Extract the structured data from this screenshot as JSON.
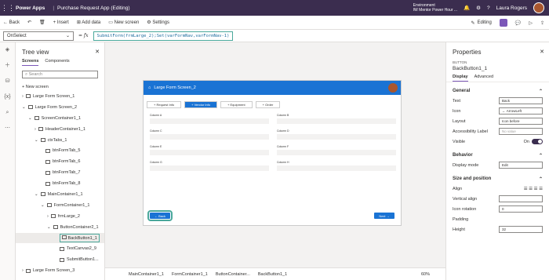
{
  "topbar": {
    "app": "Power Apps",
    "title": "Purchase Request App (Editing)",
    "env_label": "Environment",
    "env_name": "IW Mentor Power Hour ...",
    "user": "Laura Rogers"
  },
  "cmdbar": {
    "back": "Back",
    "insert": "Insert",
    "add_data": "Add data",
    "new_screen": "New screen",
    "settings": "Settings",
    "editing": "Editing"
  },
  "formula": {
    "property": "OnSelect",
    "expression": "SubmitForm(frmLarge_2);Set(varFormNav,varFormNav-1)"
  },
  "tree": {
    "title": "Tree view",
    "tabs": [
      "Screens",
      "Components"
    ],
    "search_placeholder": "Search",
    "new_screen": "New screen",
    "nodes": [
      "Large Form Screen_1",
      "Large Form Screen_2",
      "ScreenContainer1_1",
      "HeaderContainer1_1",
      "ctxTabs_1",
      "btnFormTab_5",
      "btnFormTab_6",
      "btnFormTab_7",
      "btnFormTab_8",
      "MainContainer1_1",
      "FormContainer1_1",
      "frmLarge_2",
      "ButtonContainer2_1",
      "BackButton1_1",
      "TextCanvas2_9",
      "SubmitButton1...",
      "Large Form Screen_3"
    ]
  },
  "screen": {
    "title": "Large Form Screen_2",
    "tabs": [
      "Request Info",
      "Vendor Info",
      "Equipment",
      "Order"
    ],
    "fields": [
      "Column A",
      "Column B",
      "Column C",
      "Column D",
      "Column E",
      "Column F",
      "Column G",
      "Column H"
    ],
    "back": "Back",
    "next": "Next"
  },
  "bottombar": {
    "crumbs": [
      "MainContainer1_1",
      "FormContainer1_1",
      "ButtonContainer...",
      "BackButton1_1"
    ],
    "zoom": "60%"
  },
  "props": {
    "title": "Properties",
    "type": "BUTTON",
    "name": "BackButton1_1",
    "tabs": [
      "Display",
      "Advanced"
    ],
    "general": "General",
    "text_label": "Text",
    "text_value": "Back",
    "icon_label": "Icon",
    "icon_value": "ArrowLeft",
    "layout_label": "Layout",
    "layout_value": "Icon before",
    "acc_label": "Accessibility Label",
    "acc_value": "No value",
    "visible_label": "Visible",
    "visible_value": "On",
    "behavior": "Behavior",
    "display_mode_label": "Display mode",
    "display_mode_value": "Edit",
    "size": "Size and position",
    "align_label": "Align",
    "valign_label": "Vertical align",
    "rotation_label": "Icon rotation",
    "rotation_value": "0",
    "padding_label": "Padding",
    "height_label": "Height",
    "height_value": "32"
  }
}
